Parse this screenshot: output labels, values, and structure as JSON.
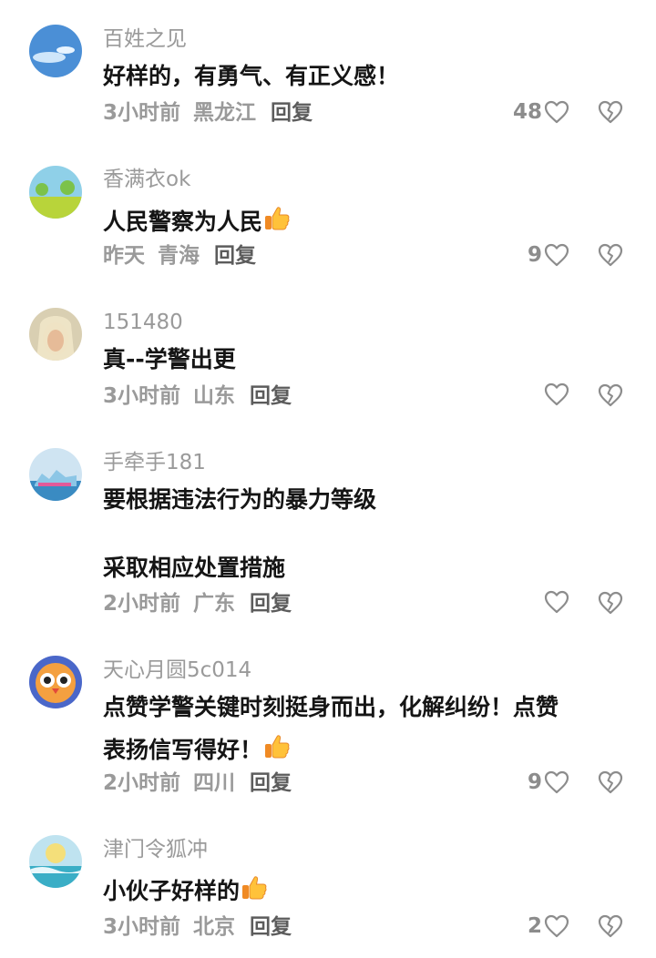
{
  "comments": [
    {
      "user": "百姓之见",
      "text": "好样的，有勇气、有正义感！",
      "time": "3小时前",
      "location": "黑龙江",
      "reply": "回复",
      "likes": "48",
      "emoji": ""
    },
    {
      "user": "香满衣ok",
      "text": "人民警察为人民",
      "time": "昨天",
      "location": "青海",
      "reply": "回复",
      "likes": "9",
      "emoji": "thumbs-up"
    },
    {
      "user": "151480",
      "text": "真--学警出更",
      "time": "3小时前",
      "location": "山东",
      "reply": "回复",
      "likes": "",
      "emoji": ""
    },
    {
      "user": "手牵手181",
      "text_line1": "要根据违法行为的暴力等级",
      "text_line2": "采取相应处置措施",
      "time": "2小时前",
      "location": "广东",
      "reply": "回复",
      "likes": "",
      "emoji": ""
    },
    {
      "user": "天心月圆5c014",
      "text_line1": "点赞学警关键时刻挺身而出，化解纠纷！点赞",
      "text_line2": "表扬信写得好！",
      "time": "2小时前",
      "location": "四川",
      "reply": "回复",
      "likes": "9",
      "emoji": "thumbs-up"
    },
    {
      "user": "津门令狐冲",
      "text": "小伙子好样的",
      "time": "3小时前",
      "location": "北京",
      "reply": "回复",
      "likes": "2",
      "emoji": "thumbs-up"
    }
  ],
  "icons": {
    "like": "heart-outline-icon",
    "dislike": "broken-heart-icon",
    "emoji": "thumbs-up-emoji"
  },
  "colors": {
    "username": "#9a9a9a",
    "text": "#151515",
    "meta": "#9a9a9a",
    "reply": "#5c5c5c",
    "icon": "#8c8c8c"
  }
}
